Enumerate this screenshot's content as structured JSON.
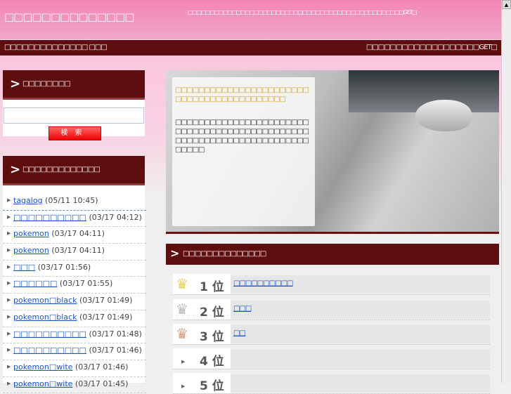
{
  "header": {
    "title": "□□□□□□□□□□□□□□",
    "tagline": "□□□□□□□□□□□□□□□□□□□□□□□□□□□□□□□□□□□□□□□□□□□□□□□□□GET□"
  },
  "nav": {
    "left": "□□□□□□□□□□□□□□ □□□",
    "right": "□□□□□□□□□□□□□□□□□□□GET□"
  },
  "sidebar": {
    "search_heading": "□□□□□□□□",
    "search_value": "",
    "search_button": "検索",
    "recent_heading": "□□□□□□□□□□□□□",
    "items": [
      {
        "label": "tagalog",
        "time": "(05/11 10:45)"
      },
      {
        "label": "□□□□□□□□□□",
        "time": "(03/17 04:12)"
      },
      {
        "label": "pokemon",
        "time": "(03/17 04:11)"
      },
      {
        "label": "pokemon",
        "time": "(03/17 04:11)"
      },
      {
        "label": "□□□",
        "time": "(03/17 01:56)"
      },
      {
        "label": "□□□□□□",
        "time": "(03/17 01:55)"
      },
      {
        "label": "pokemon□black",
        "time": "(03/17 01:49)"
      },
      {
        "label": "pokemon□black",
        "time": "(03/17 01:49)"
      },
      {
        "label": "□□□□□□□□□□",
        "time": "(03/17 01:48)"
      },
      {
        "label": "□□□□□□□□□□",
        "time": "(03/17 01:46)"
      },
      {
        "label": "pokemon□wite",
        "time": "(03/17 01:46)"
      },
      {
        "label": "pokemon□wite",
        "time": "(03/17 01:45)"
      }
    ]
  },
  "hero": {
    "heading": "□□□□□□□□□□□□□□□□□□□□□□□□□□□□□□□□□□□□□□□□□□",
    "body": "□□□□□□□□□□□□□□□□□□□□□□□□□□□□□□□□□□□□□□□□□□□□□□□□□□□□□□□□□□□□□□□□□□□□□□□□□□"
  },
  "ranking": {
    "heading": "□□□□□□□□□□□□□□",
    "rows": [
      {
        "rank": "1 位",
        "crown": "gold",
        "label": "□□□□□□□□□□"
      },
      {
        "rank": "2 位",
        "crown": "silver",
        "label": "□□□"
      },
      {
        "rank": "3 位",
        "crown": "bronze",
        "label": "□□"
      },
      {
        "rank": "4 位",
        "crown": "none",
        "label": " "
      },
      {
        "rank": "5 位",
        "crown": "none",
        "label": ""
      }
    ]
  }
}
